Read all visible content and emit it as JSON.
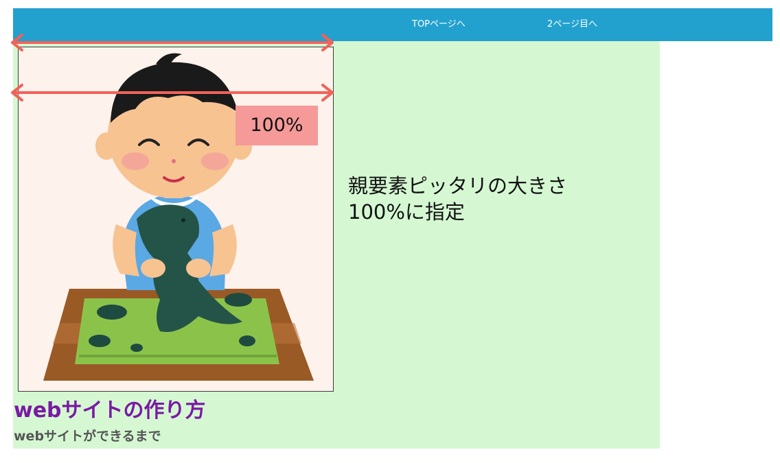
{
  "nav": {
    "top_link": "TOPページへ",
    "page2_link": "2ページ目へ"
  },
  "annotation": {
    "percent_label": "100%",
    "description_line1": "親要素ピッタリの大きさ",
    "description_line2": "100%に指定"
  },
  "site": {
    "title": "webサイトの作り方",
    "subtitle": "webサイトができるまで"
  },
  "colors": {
    "nav_bar": "#22a1cf",
    "content_background": "#d5f8d3",
    "arrow": "#f2625a",
    "percent_tag": "#f59999",
    "title": "#7a1aa3"
  },
  "icons": {
    "illustration": "boy-making-clay-dinosaur-illustration",
    "arrow": "double-headed-width-arrow"
  }
}
